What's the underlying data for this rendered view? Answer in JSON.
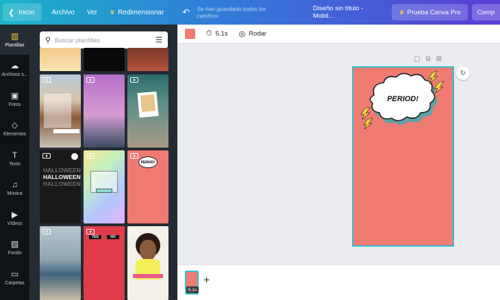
{
  "topbar": {
    "home_label": "Inicio",
    "file_label": "Archivo",
    "view_label": "Ver",
    "resize_label": "Redimensionar",
    "saved_status": "Se han guardado todos los cambios",
    "doc_title": "Diseño sin título - Mobil...",
    "pro_label": "Prueba Canva Pro",
    "share_label": "Comp"
  },
  "sidebar": {
    "items": [
      {
        "label": "Plantillas",
        "icon": "templates-icon"
      },
      {
        "label": "Archivos s...",
        "icon": "upload-icon"
      },
      {
        "label": "Fotos",
        "icon": "photos-icon"
      },
      {
        "label": "Elementos",
        "icon": "elements-icon"
      },
      {
        "label": "Texto",
        "icon": "text-icon"
      },
      {
        "label": "Música",
        "icon": "music-icon"
      },
      {
        "label": "Vídeos",
        "icon": "video-icon"
      },
      {
        "label": "Fondo",
        "icon": "background-icon"
      },
      {
        "label": "Carpetas",
        "icon": "folder-icon"
      }
    ]
  },
  "templates_panel": {
    "search_placeholder": "Buscar plantillas",
    "halloween_text": "HALLOWEEN",
    "period_text": "PERIOD!",
    "yes_label": "YES",
    "no_label": "NO"
  },
  "edit_toolbar": {
    "color": "#ee7a72",
    "duration": "5.1s",
    "animate_label": "Rodar"
  },
  "design": {
    "background": "#ef7b73",
    "burst_text": "PERIOD!"
  },
  "timeline": {
    "page_duration": "5.1s"
  }
}
